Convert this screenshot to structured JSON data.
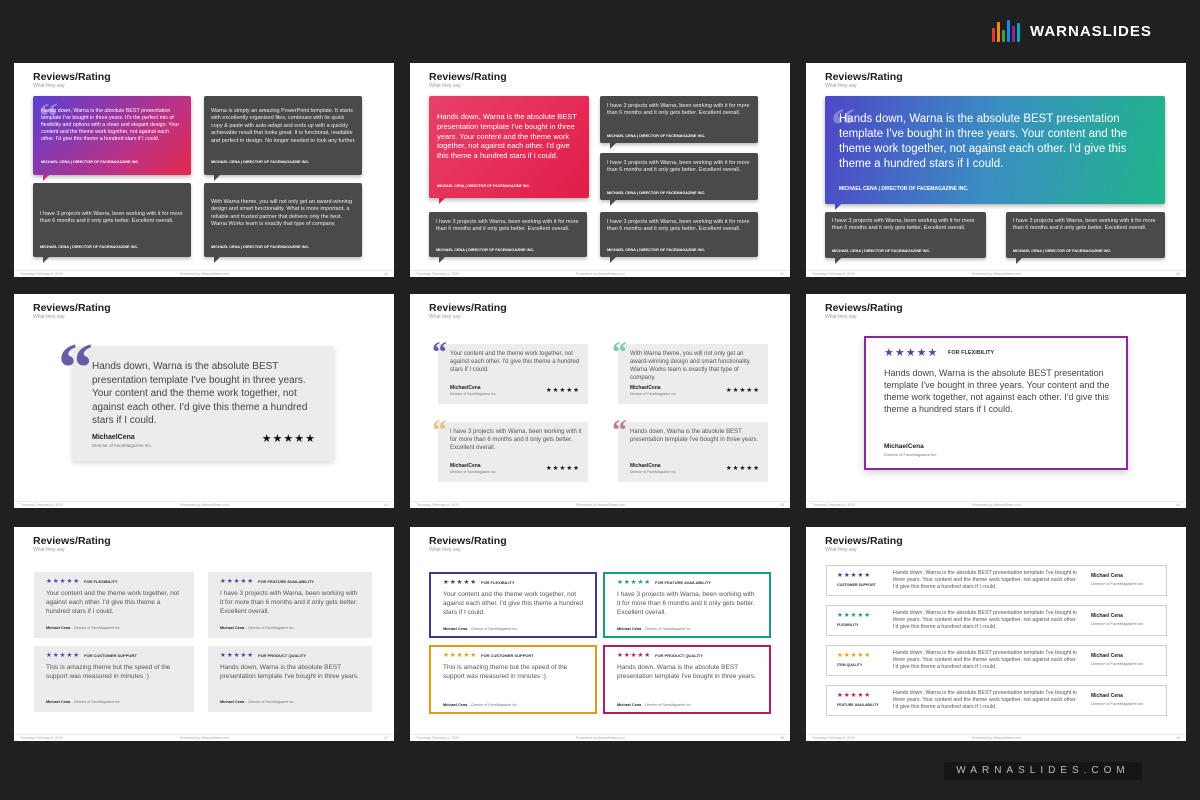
{
  "brand": {
    "name": "WARNASLIDES",
    "bar_colors": [
      "#e53935",
      "#fb8c00",
      "#43a047",
      "#1e88e5",
      "#8e24aa",
      "#00acc1"
    ]
  },
  "footer_brand": "WARNASLIDES.COM",
  "slide_common": {
    "title": "Reviews/Rating",
    "subtitle": "What they say",
    "footer_left": "Thursday, February 6, 2020",
    "footer_center": "Presented by WarnaSlides.com"
  },
  "slide_numbers": [
    "41",
    "42",
    "43",
    "44",
    "45",
    "46",
    "47",
    "48",
    "49"
  ],
  "person": {
    "name": "MICHAEL CENA | DIRECTOR OF FACEMAGAZINE INC.",
    "short_name": "MichaelCena",
    "role": "Director of FaceMagazine Inc.",
    "name_sp": "Michael Cena",
    "role_dash": "- Director of FaceMagazine Inc."
  },
  "texts": {
    "best": "Hands down, Warna is the absolute BEST presentation template I've bought in three years. It's the perfect mix of flexibility and options with a clean and elegant design. Your content and the theme work together, not against each other. I'd give this theme a hundred stars if I could.",
    "simple": "Warna is simply an amazing PowerPoint template. It starts with excellently organized files, continues with its quick copy & paste with auto-adapt and ends up with a quickly achievable result that looks great. It is functional, readable and perfect in design. No longer needed to look any further.",
    "three_years": "I have 3 projects with Warna, been working with it for more than 6 months and it only gets better. Excellent overall.",
    "award": "With Warna theme, you will not only get an award-winning design and smart functionality. What is more important, a reliable and trusted partner that delivers only the best. Warna Works team is exactly that type of company.",
    "best_short": "Hands down, Warna is the absolute BEST presentation template I've bought in three years. Your content and the theme work together, not against each other. I'd give this theme a hundred stars if I could.",
    "content_theme": "Your content and the theme work together, not against each other. I'd give this theme a hundred stars if I could.",
    "award_short": "With Warna theme, you will not only get an award-winning design and smart functionality. Warna Works team is exactly that type of company.",
    "best_brief": "Hands down, Warna is the absolute BEST presentation template I've bought in three years.",
    "support": "This is amazing theme but the speed of the support was measured in minutes :)",
    "projects_short": "I have 3 projects with Warna, been working with it for more than 6 months and it only gets better. Excellent overall."
  },
  "stars": "★★★★★",
  "labels": {
    "flex": "FOR FLEXIBILITY",
    "feature": "FOR FEATURE AVAILABILITY",
    "support": "FOR CUSTOMER SUPPORT",
    "quality": "FOR PRODUCT QUALITY",
    "cs": "CUSTOMER SUPPORT",
    "fl": "FLEXIBILITY",
    "iq": "ITEM QUALITY",
    "fa": "FEATURE AVAILABILITY"
  },
  "colors": {
    "purple": "#3f3a8f",
    "teal": "#1a9b7d",
    "orange": "#e59a16",
    "magenta": "#b51d5c",
    "violet": "#6a3d9a",
    "quote_purple": "#6b5aa6",
    "quote_teal": "#7ac8b5",
    "quote_orange": "#e8c28a",
    "quote_mauve": "#c27b95"
  }
}
